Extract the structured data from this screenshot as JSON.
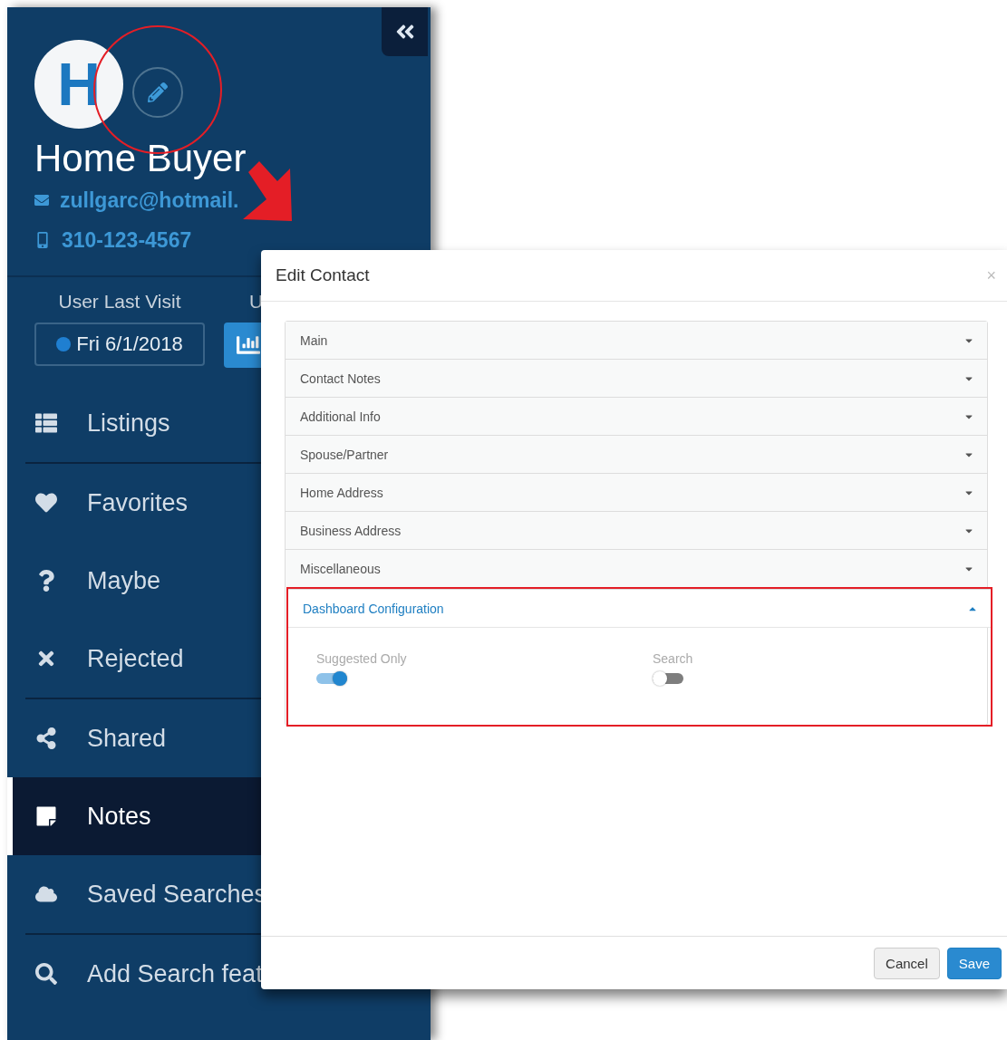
{
  "sidebar": {
    "avatar": {
      "initial": "H"
    },
    "name": "Home Buyer",
    "email": "zullgarc@hotmail.",
    "phone": "310-123-4567",
    "stats": [
      {
        "label": "User Last Visit",
        "value": "Fri 6/1/2018"
      },
      {
        "label": "U"
      }
    ],
    "nav": [
      {
        "label": "Listings",
        "selected": false
      },
      {
        "label": "Favorites",
        "selected": false
      },
      {
        "label": "Maybe",
        "selected": false
      },
      {
        "label": "Rejected",
        "selected": false
      },
      {
        "label": "Shared",
        "selected": false
      },
      {
        "label": "Notes",
        "selected": true
      },
      {
        "label": "Saved Searches",
        "selected": false
      },
      {
        "label": "Add Search feat",
        "selected": false
      }
    ]
  },
  "modal": {
    "title": "Edit Contact",
    "close": "×",
    "sections": [
      {
        "label": "Main",
        "expanded": false
      },
      {
        "label": "Contact Notes",
        "expanded": false
      },
      {
        "label": "Additional Info",
        "expanded": false
      },
      {
        "label": "Spouse/Partner",
        "expanded": false
      },
      {
        "label": "Home Address",
        "expanded": false
      },
      {
        "label": "Business Address",
        "expanded": false
      },
      {
        "label": "Miscellaneous",
        "expanded": false
      },
      {
        "label": "Dashboard Configuration",
        "expanded": true,
        "toggles": [
          {
            "label": "Suggested Only",
            "on": true
          },
          {
            "label": "Search",
            "on": false
          }
        ]
      }
    ],
    "buttons": [
      {
        "label": "Cancel",
        "kind": "default"
      },
      {
        "label": "Save",
        "kind": "primary"
      }
    ]
  },
  "annotations": [
    {
      "kind": "circle"
    },
    {
      "kind": "arrow"
    },
    {
      "kind": "box"
    }
  ]
}
